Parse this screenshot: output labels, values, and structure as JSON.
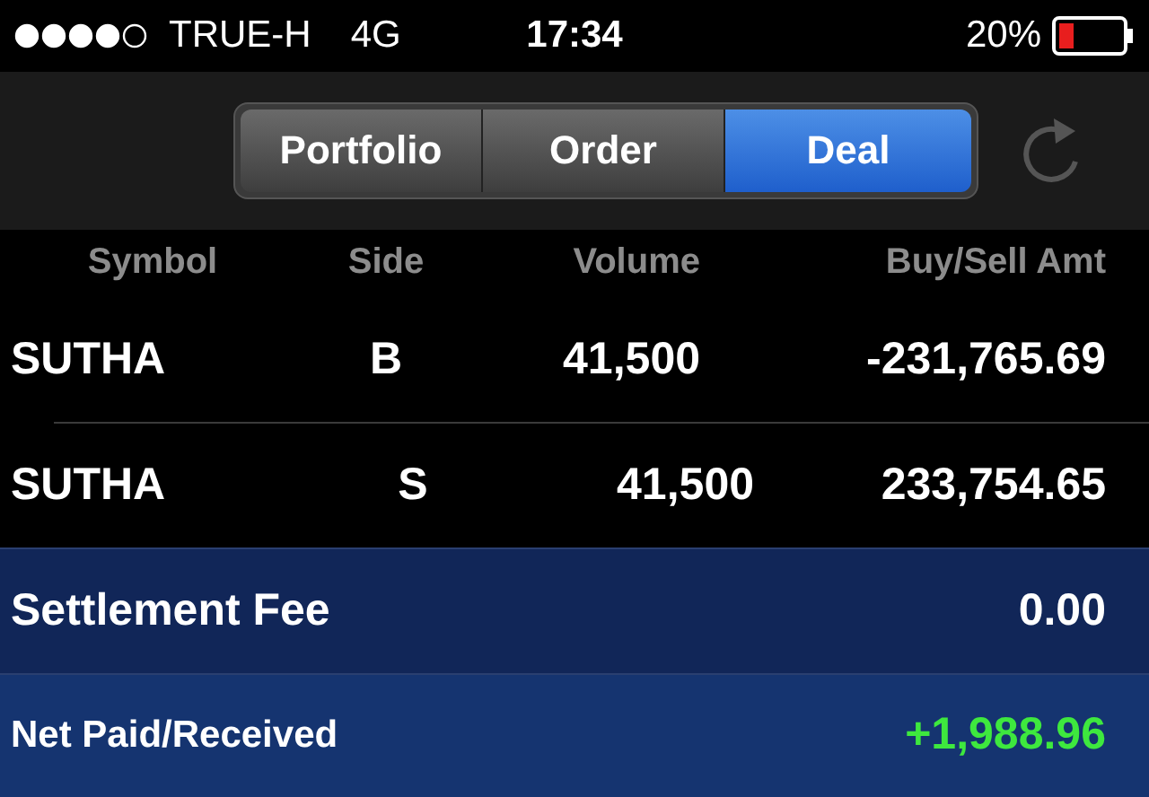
{
  "status_bar": {
    "carrier": "TRUE-H",
    "network": "4G",
    "time": "17:34",
    "battery_text": "20%"
  },
  "tabs": [
    {
      "label": "Portfolio",
      "selected": false
    },
    {
      "label": "Order",
      "selected": false
    },
    {
      "label": "Deal",
      "selected": true
    }
  ],
  "table": {
    "columns": [
      "Symbol",
      "Side",
      "Volume",
      "Buy/Sell Amt"
    ],
    "rows": [
      {
        "symbol": "SUTHA",
        "side": "B",
        "volume": "41,500",
        "amount": "-231,765.69"
      },
      {
        "symbol": "SUTHA",
        "side": "S",
        "volume": "41,500",
        "amount": "233,754.65"
      }
    ]
  },
  "summary": [
    {
      "kind": "fee",
      "label": "Settlement Fee",
      "value": "0.00"
    },
    {
      "kind": "net",
      "label": "Net Paid/Received",
      "value": "+1,988.96"
    }
  ]
}
